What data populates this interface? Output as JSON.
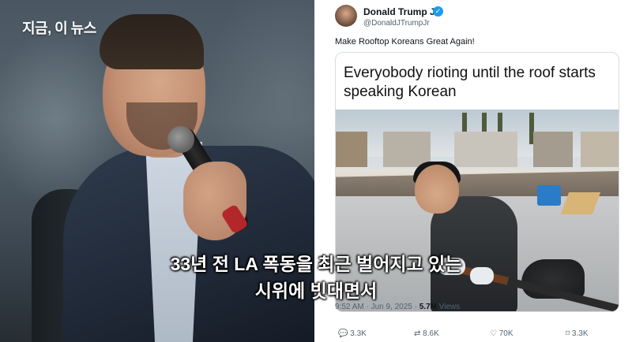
{
  "broadcast": {
    "logo": "지금, 이 뉴스"
  },
  "tweet": {
    "user_name": "Donald Trump Jr.",
    "verified_mark": "✓",
    "user_handle": "@DonaldJTrumpJr",
    "text": "Make Rooftop Koreans Great Again!",
    "meme_caption": "Everyobody rioting until the roof starts speaking Korean",
    "timestamp": "9:52 AM · Jun 9, 2025 · ",
    "views_count": "5.7M",
    "views_label": " Views",
    "replies": "3.3K",
    "reposts": "8.6K",
    "likes": "70K",
    "bookmarks": "3.3K"
  },
  "subtitle": {
    "line1": "33년 전 LA 폭동을 최근 벌어지고 있는",
    "line2": "시위에 빗대면서"
  },
  "colors": {
    "verified": "#1d9bf0",
    "text_primary": "#0f1419",
    "text_secondary": "#536471"
  }
}
